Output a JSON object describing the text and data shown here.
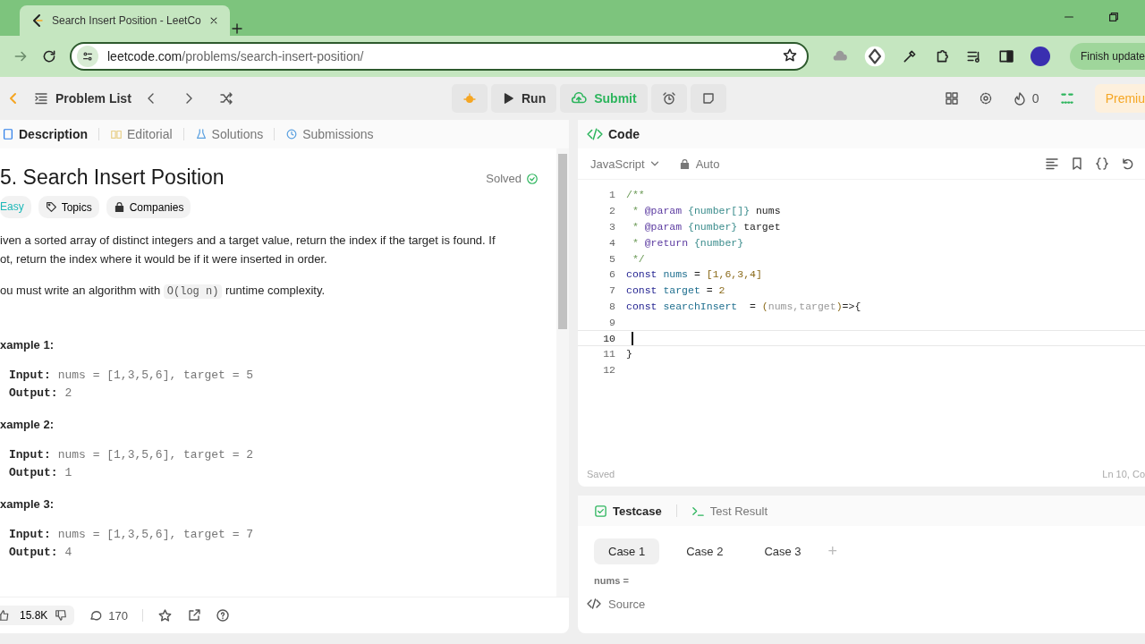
{
  "browser": {
    "tab_title": "Search Insert Position - LeetCo",
    "url_domain": "leetcode.com",
    "url_path": "/problems/search-insert-position/",
    "update_button": "Finish update"
  },
  "nav": {
    "problem_list": "Problem List",
    "run": "Run",
    "submit": "Submit",
    "streak": "0",
    "premium": "Premiu"
  },
  "left_tabs": [
    {
      "label": "Description",
      "selected": true
    },
    {
      "label": "Editorial",
      "selected": false
    },
    {
      "label": "Solutions",
      "selected": false
    },
    {
      "label": "Submissions",
      "selected": false
    }
  ],
  "problem": {
    "title": "5. Search Insert Position",
    "status": "Solved",
    "difficulty": "Easy",
    "tags": [
      "Topics",
      "Companies"
    ],
    "description_lines": [
      "iven a sorted array of distinct integers and a target value, return the index if the target is found. If",
      "ot, return the index where it would be if it were inserted in order."
    ],
    "complexity": {
      "before": "ou must write an algorithm with ",
      "code": "O(log n)",
      "after": " runtime complexity."
    },
    "examples": [
      {
        "title": "xample 1:",
        "input_label": "Input:",
        "input": "nums = [1,3,5,6], target = 5",
        "output_label": "Output:",
        "output": "2"
      },
      {
        "title": "xample 2:",
        "input_label": "Input:",
        "input": "nums = [1,3,5,6], target = 2",
        "output_label": "Output:",
        "output": "1"
      },
      {
        "title": "xample 3:",
        "input_label": "Input:",
        "input": "nums = [1,3,5,6], target = 7",
        "output_label": "Output:",
        "output": "4"
      }
    ],
    "likes": "15.8K",
    "comments": "170"
  },
  "editor": {
    "title": "Code",
    "language": "JavaScript",
    "mode": "Auto",
    "status": "Saved",
    "position": "Ln 10, Co",
    "lines": [
      {
        "number": "1",
        "current": false,
        "tokens": [
          {
            "kind": "comment",
            "text": "/**"
          }
        ]
      },
      {
        "number": "2",
        "current": false,
        "tokens": [
          {
            "kind": "comment",
            "text": " * "
          },
          {
            "kind": "tag",
            "text": "@param"
          },
          {
            "kind": "type",
            "text": " {number[]}"
          },
          {
            "kind": "plain",
            "text": " nums"
          }
        ]
      },
      {
        "number": "3",
        "current": false,
        "tokens": [
          {
            "kind": "comment",
            "text": " * "
          },
          {
            "kind": "tag",
            "text": "@param"
          },
          {
            "kind": "type",
            "text": " {number}"
          },
          {
            "kind": "plain",
            "text": " target"
          }
        ]
      },
      {
        "number": "4",
        "current": false,
        "tokens": [
          {
            "kind": "comment",
            "text": " * "
          },
          {
            "kind": "tag",
            "text": "@return"
          },
          {
            "kind": "type",
            "text": " {number}"
          }
        ]
      },
      {
        "number": "5",
        "current": false,
        "tokens": [
          {
            "kind": "comment",
            "text": " */"
          }
        ]
      },
      {
        "number": "6",
        "current": false,
        "tokens": [
          {
            "kind": "keyword",
            "text": "const"
          },
          {
            "kind": "var",
            "text": " nums"
          },
          {
            "kind": "plain",
            "text": " = "
          },
          {
            "kind": "number",
            "text": "[1,6,3,4]"
          }
        ]
      },
      {
        "number": "7",
        "current": false,
        "tokens": [
          {
            "kind": "keyword",
            "text": "const"
          },
          {
            "kind": "var",
            "text": " target"
          },
          {
            "kind": "plain",
            "text": " = "
          },
          {
            "kind": "number",
            "text": "2"
          }
        ]
      },
      {
        "number": "8",
        "current": false,
        "tokens": [
          {
            "kind": "keyword",
            "text": "const"
          },
          {
            "kind": "var",
            "text": " searchInsert"
          },
          {
            "kind": "plain",
            "text": "  = "
          },
          {
            "kind": "number",
            "text": "("
          },
          {
            "kind": "param",
            "text": "nums,target"
          },
          {
            "kind": "number",
            "text": ")"
          },
          {
            "kind": "plain",
            "text": "=>{"
          }
        ]
      },
      {
        "number": "9",
        "current": false
      },
      {
        "number": "10",
        "current": true
      },
      {
        "number": "11",
        "current": false,
        "tokens": [
          {
            "kind": "plain",
            "text": "}"
          }
        ]
      },
      {
        "number": "12",
        "current": false
      }
    ]
  },
  "bottom_tabs": [
    {
      "label": "Testcase",
      "selected": true
    },
    {
      "label": "Test Result",
      "selected": false
    }
  ],
  "cases": [
    {
      "label": "Case 1",
      "selected": true
    },
    {
      "label": "Case 2",
      "selected": false
    },
    {
      "label": "Case 3",
      "selected": false
    }
  ],
  "add_case": "+",
  "input_label": "nums =",
  "source": "Source"
}
